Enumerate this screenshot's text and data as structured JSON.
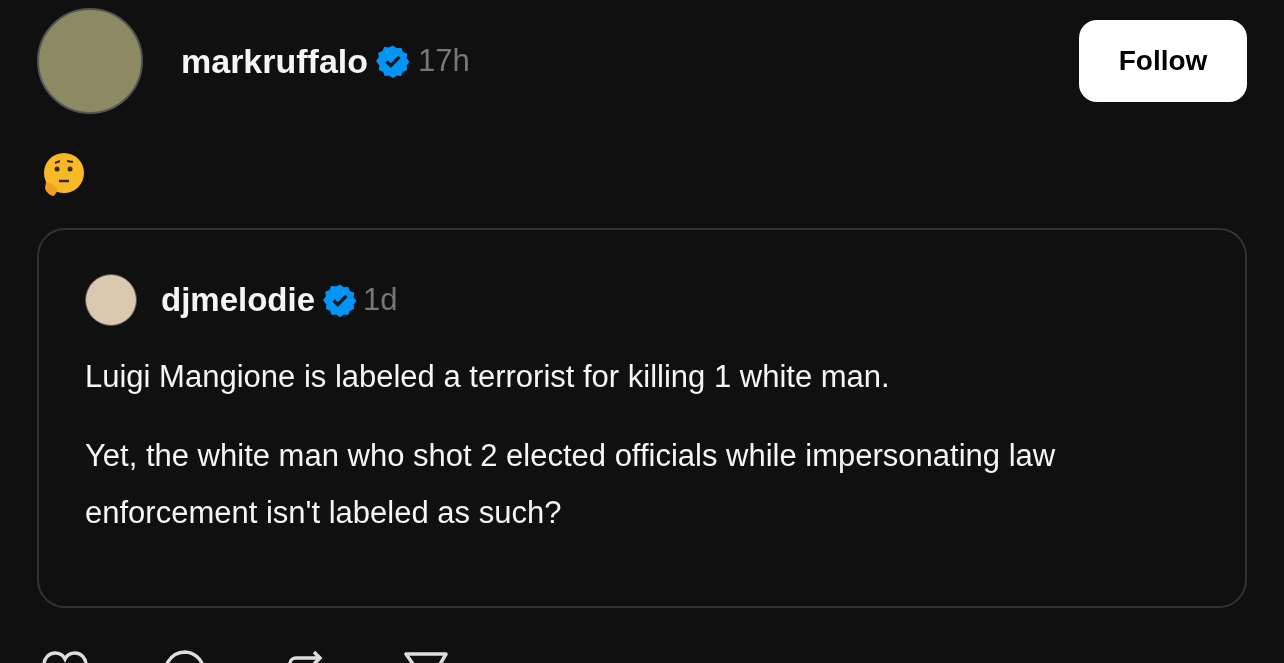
{
  "post": {
    "author": "markruffalo",
    "verified": true,
    "time": "17h",
    "follow_button": "Follow"
  },
  "quoted_post": {
    "author": "djmelodie",
    "verified": true,
    "time": "1d",
    "paragraphs": [
      "Luigi Mangione is labeled a terrorist for killing 1 white man.",
      "Yet, the white man who shot 2 elected officials while impersonating law enforcement isn't labeled as such?"
    ]
  }
}
